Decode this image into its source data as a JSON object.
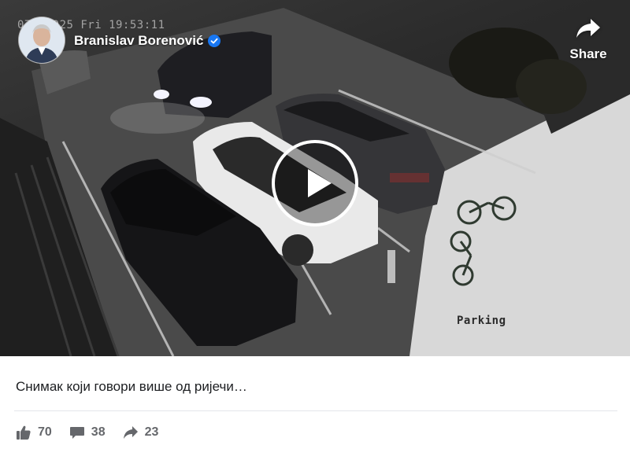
{
  "post": {
    "author_name": "Branislav Borenović",
    "verified": true,
    "share_label": "Share",
    "caption": "Снимак који говори више од ријечи…"
  },
  "video": {
    "timestamp": "07-  2025 Fri 19:53:11",
    "overlay_text": "Parking"
  },
  "stats": {
    "likes": "70",
    "comments": "38",
    "shares": "23"
  },
  "icons": {
    "share": "share-arrow-icon",
    "play": "play-icon",
    "verified": "verified-badge-icon",
    "like": "thumbs-up-icon",
    "comment": "comment-bubble-icon",
    "share_count": "share-arrow-icon"
  },
  "colors": {
    "verified_blue": "#1877f2",
    "meta_text": "#65676b",
    "caption_text": "#1c1e21"
  }
}
